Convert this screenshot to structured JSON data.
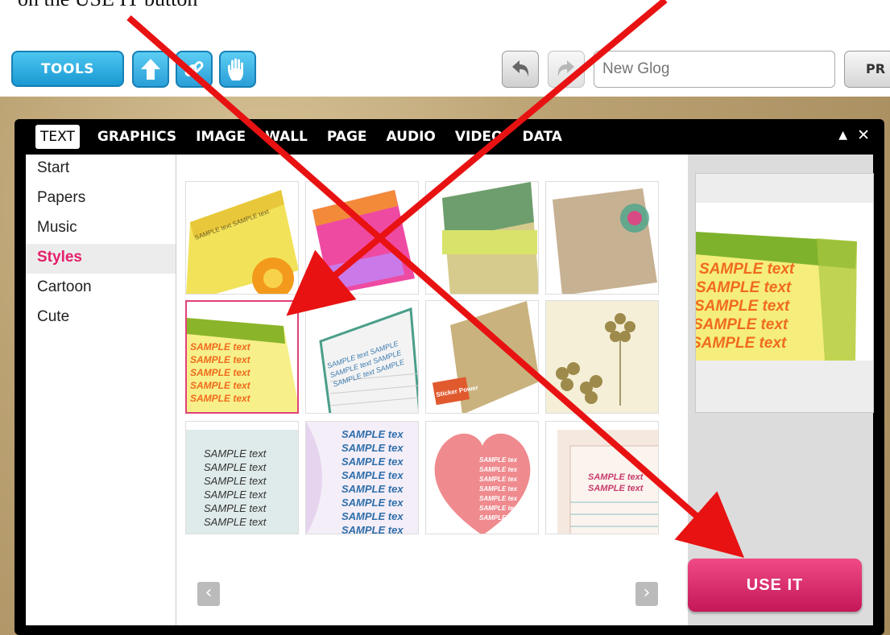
{
  "caption": "on the USE IT button",
  "toolbar": {
    "tools_label": "TOOLS",
    "title_placeholder": "New Glog",
    "preview_label": "PR"
  },
  "tabs": [
    "TEXT",
    "GRAPHICS",
    "IMAGE",
    "WALL",
    "PAGE",
    "AUDIO",
    "VIDEO",
    "DATA"
  ],
  "sidebar": {
    "items": [
      {
        "label": "Start"
      },
      {
        "label": "Papers"
      },
      {
        "label": "Music"
      },
      {
        "label": "Styles"
      },
      {
        "label": "Cartoon"
      },
      {
        "label": "Cute"
      }
    ],
    "active_index": 3
  },
  "thumbnails": {
    "sample_text": "SAMPLE text",
    "sample_tex": "SAMPLE tex",
    "sticker_text": "Sticker Power"
  },
  "preview": {
    "sample_text": "SAMPLE text"
  },
  "use_it_label": "USE IT",
  "colors": {
    "accent_pink": "#e51f6b",
    "tools_blue": "#1a99d2",
    "arrow_red": "#e81212"
  }
}
